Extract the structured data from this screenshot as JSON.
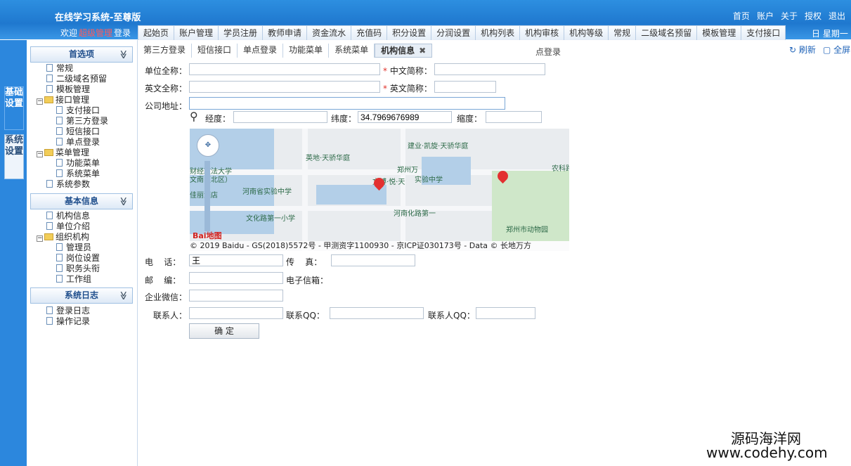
{
  "header": {
    "title": "在线学习系统-至尊版",
    "links": [
      "首页",
      "账户",
      "关于",
      "授权",
      "退出"
    ],
    "welcome_prefix": "欢迎",
    "welcome_user": "超级管理",
    "welcome_suffix": "登录",
    "weekday": "日 星期一"
  },
  "topnav": [
    "起始页",
    "账户管理",
    "学员注册",
    "教师申请",
    "资金流水",
    "充值码",
    "积分设置",
    "分润设置",
    "机构列表",
    "机构审核",
    "机构等级",
    "常规",
    "二级域名预留",
    "模板管理",
    "支付接口"
  ],
  "left_tabs": [
    "基础设置",
    "系统设置"
  ],
  "sidebar": {
    "sections": [
      {
        "title": "首选项",
        "items": [
          {
            "label": "常规",
            "level": 1,
            "type": "doc"
          },
          {
            "label": "二级域名预留",
            "level": 1,
            "type": "doc"
          },
          {
            "label": "模板管理",
            "level": 1,
            "type": "doc"
          },
          {
            "label": "接口管理",
            "level": 0,
            "type": "folder"
          },
          {
            "label": "支付接口",
            "level": 2,
            "type": "doc"
          },
          {
            "label": "第三方登录",
            "level": 2,
            "type": "doc"
          },
          {
            "label": "短信接口",
            "level": 2,
            "type": "doc"
          },
          {
            "label": "单点登录",
            "level": 2,
            "type": "doc"
          },
          {
            "label": "菜单管理",
            "level": 0,
            "type": "folder"
          },
          {
            "label": "功能菜单",
            "level": 2,
            "type": "doc"
          },
          {
            "label": "系统菜单",
            "level": 2,
            "type": "doc"
          },
          {
            "label": "系统参数",
            "level": 1,
            "type": "doc"
          }
        ]
      },
      {
        "title": "基本信息",
        "items": [
          {
            "label": "机构信息",
            "level": 1,
            "type": "doc"
          },
          {
            "label": "单位介绍",
            "level": 1,
            "type": "doc"
          },
          {
            "label": "组织机构",
            "level": 0,
            "type": "folder"
          },
          {
            "label": "管理员",
            "level": 2,
            "type": "doc"
          },
          {
            "label": "岗位设置",
            "level": 2,
            "type": "doc"
          },
          {
            "label": "职务头衔",
            "level": 2,
            "type": "doc"
          },
          {
            "label": "工作组",
            "level": 2,
            "type": "doc"
          }
        ]
      },
      {
        "title": "系统日志",
        "items": [
          {
            "label": "登录日志",
            "level": 1,
            "type": "doc"
          },
          {
            "label": "操作记录",
            "level": 1,
            "type": "doc"
          }
        ]
      }
    ]
  },
  "subtabs": [
    "第三方登录",
    "短信接口",
    "单点登录",
    "功能菜单",
    "系统菜单",
    "机构信息"
  ],
  "subtab_close": "✖",
  "subtab_ghost": "点登录",
  "toolbar": {
    "refresh": "刷新",
    "fullscreen": "全屏"
  },
  "form": {
    "org_full_name": {
      "label": "单位全称：",
      "value": ""
    },
    "cn_short": {
      "label": "中文简称：",
      "value": ""
    },
    "en_full_name": {
      "label": "英文全称：",
      "value": ""
    },
    "en_short": {
      "label": "英文简称：",
      "value": ""
    },
    "address": {
      "label": "公司地址：",
      "value": ""
    },
    "longitude": {
      "label": "经度：",
      "value": ""
    },
    "latitude": {
      "label": "纬度：",
      "value": "34.7969676989"
    },
    "zoom": {
      "label": "缩度：",
      "value": ""
    },
    "phone": {
      "label": "电    话：",
      "value": "王"
    },
    "fax": {
      "label": "传    真：",
      "value": ""
    },
    "postcode": {
      "label": "邮    编：",
      "value": ""
    },
    "email": {
      "label": "电子信箱：",
      "value": ""
    },
    "wechat": {
      "label": "企业微信：",
      "value": ""
    },
    "contact": {
      "label": "联系人：",
      "value": ""
    },
    "contact_qq": {
      "label": "联系QQ：",
      "value": ""
    },
    "contact_qq2": {
      "label": "联系人QQ：",
      "value": ""
    },
    "submit": "确 定"
  },
  "map": {
    "labels": [
      "英地·天骄华庭",
      "建业·凯旋·天骄华庭",
      "郑州万",
      "河南省实验中学",
      "文博·悦·天",
      "实验中学",
      "文化路第一小学",
      "河南化路第一",
      "郑州市动物园",
      "财经政法大学",
      "文南（北区）",
      "佳丽酒店",
      "农科路"
    ],
    "copyright": "© 2019 Baidu - GS(2018)5572号 - 甲测资字1100930 - 京ICP证030173号 - Data © 长地万方",
    "logo": "Bai地图"
  },
  "watermark": {
    "line1": "源码海洋网",
    "line2": "www.codehy.com"
  }
}
